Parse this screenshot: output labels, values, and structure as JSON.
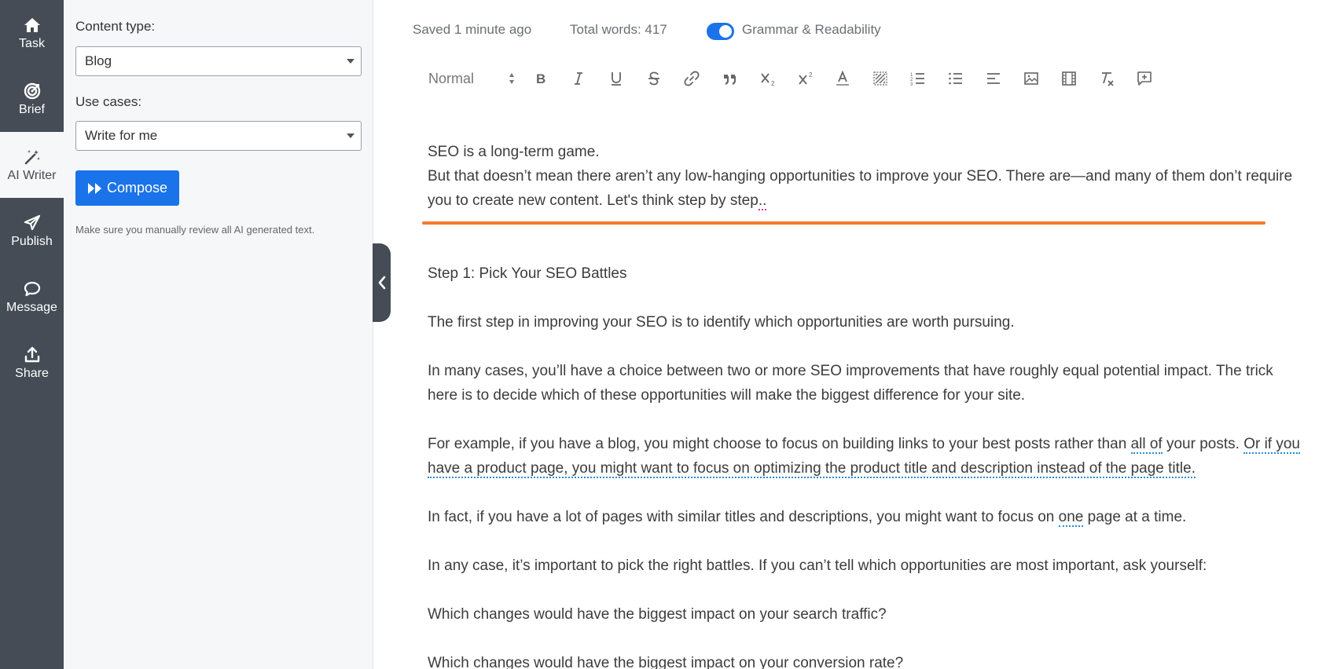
{
  "nav": {
    "items": [
      {
        "label": "Task",
        "icon": "home-icon"
      },
      {
        "label": "Brief",
        "icon": "target-icon"
      },
      {
        "label": "AI Writer",
        "icon": "magic-wand-icon"
      },
      {
        "label": "Publish",
        "icon": "paper-plane-icon"
      },
      {
        "label": "Message",
        "icon": "chat-bubble-icon"
      },
      {
        "label": "Share",
        "icon": "upload-icon"
      }
    ],
    "active": "AI Writer"
  },
  "panel": {
    "content_type_label": "Content type:",
    "content_type_value": "Blog",
    "use_cases_label": "Use cases:",
    "use_cases_value": "Write for me",
    "compose_label": "Compose",
    "note": "Make sure you manually review all AI generated text."
  },
  "status": {
    "saved": "Saved 1 minute ago",
    "words": "Total words: 417",
    "grammar_label": "Grammar & Readability",
    "grammar_enabled": true
  },
  "toolbar": {
    "format_value": "Normal",
    "buttons": [
      "bold-icon",
      "italic-icon",
      "underline-icon",
      "strikethrough-icon",
      "link-icon",
      "quote-icon",
      "subscript-icon",
      "superscript-icon",
      "text-color-icon",
      "highlight-icon",
      "ordered-list-icon",
      "bullet-list-icon",
      "align-left-icon",
      "image-icon",
      "video-icon",
      "clear-format-icon",
      "add-comment-icon"
    ]
  },
  "editor": {
    "intro_line1": "SEO is a long-term game.",
    "intro_line2_a": "But that doesn’t mean there aren’t any low-hanging opportunities to improve your SEO. There are—and many of them don’t require you to create new content. Let's think step by step",
    "intro_line2_b": "..",
    "heading": "Step 1: Pick Your SEO Battles",
    "p1": "The first step in improving your SEO is to identify which opportunities are worth pursuing.",
    "p2": "In many cases, you’ll have a choice between two or more SEO improvements that have roughly equal potential impact. The trick here is to decide which of these opportunities will make the biggest difference for your site.",
    "p3_a": "For example, if you have a blog, you might choose to focus on building links to your best posts rather than ",
    "p3_b": "all of",
    "p3_c": " your posts. ",
    "p3_d": "Or if you have a product page, you might want to focus on optimizing the product title and description instead of the page title.",
    "p4_a": "In fact, if you have a lot of pages with similar titles and descriptions, you might want to focus on ",
    "p4_b": "one",
    "p4_c": " page at a time.",
    "p5": "In any case, it’s important to pick the right battles. If you can’t tell which opportunities are most important, ask yourself:",
    "q1": "Which changes would have the biggest impact on your search traffic?",
    "q2": "Which changes would have the biggest impact on your conversion rate?"
  },
  "colors": {
    "rail": "#454c55",
    "accent": "#1a73e8",
    "separator": "#f47a2a"
  }
}
